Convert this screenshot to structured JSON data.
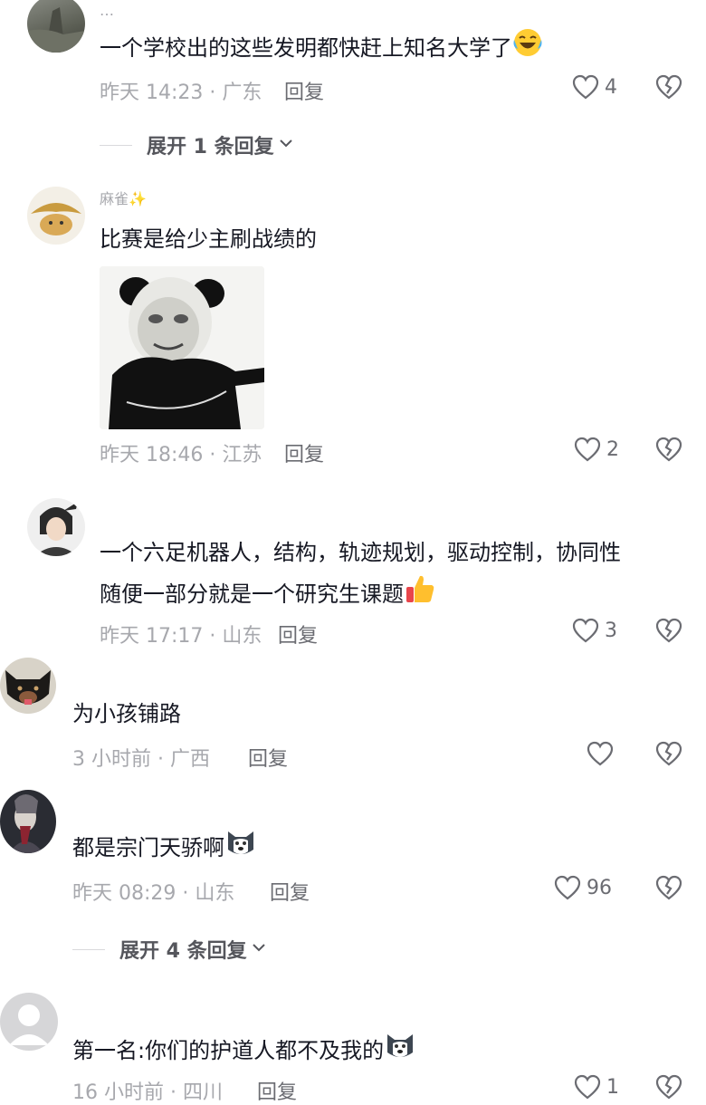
{
  "comments": [
    {
      "username": "…",
      "text": "一个学校出的这些发明都快赶上知名大学了",
      "emoji": "laughing-tears",
      "time_location": "昨天 14:23 · 广东",
      "reply_label": "回复",
      "likes": "4"
    },
    {
      "username": "麻雀✨",
      "text": "比赛是给少主刷战绩的",
      "time_location": "昨天 18:46 · 江苏",
      "reply_label": "回复",
      "likes": "2"
    },
    {
      "text_line1": "一个六足机器人，结构，轨迹规划，驱动控制，协同性",
      "text_line2": "随便一部分就是一个研究生课题",
      "emoji": "thumbs-up",
      "time_location": "昨天 17:17 · 山东",
      "reply_label": "回复",
      "likes": "3"
    },
    {
      "text": "为小孩铺路",
      "time_location": "3 小时前 · 广西",
      "reply_label": "回复",
      "likes": ""
    },
    {
      "text": "都是宗门天骄啊",
      "emoji": "husky",
      "time_location": "昨天 08:29 · 山东",
      "reply_label": "回复",
      "likes": "96"
    },
    {
      "text": "第一名:你们的护道人都不及我的",
      "emoji": "husky",
      "time_location": "16 小时前 · 四川",
      "reply_label": "回复",
      "likes": "1"
    }
  ],
  "expand_replies": [
    {
      "label": "展开 1 条回复"
    },
    {
      "label": "展开 4 条回复"
    }
  ],
  "colors": {
    "text": "#161823",
    "meta": "#a7a8ad",
    "action": "#6b6c72"
  }
}
